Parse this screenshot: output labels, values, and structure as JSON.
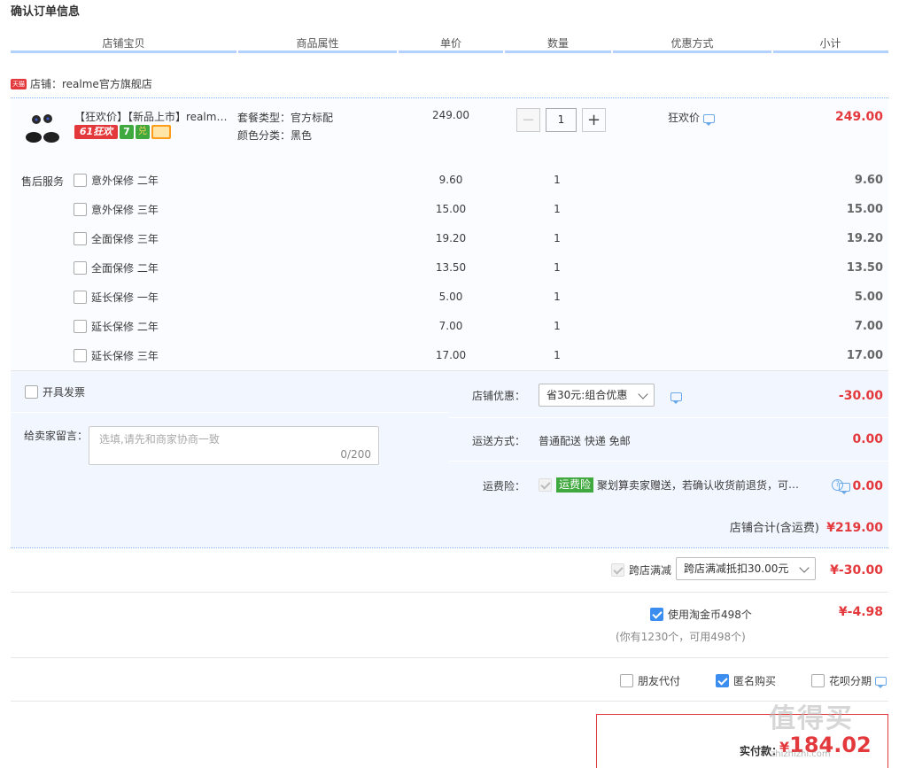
{
  "page_title": "确认订单信息",
  "columns": [
    "店铺宝贝",
    "商品属性",
    "单价",
    "数量",
    "优惠方式",
    "小计"
  ],
  "shop": {
    "badge": "天猫",
    "label": "店铺：realme官方旗舰店"
  },
  "product": {
    "title": "【狂欢价】【新品上市】realme真无线蓝牙耳机",
    "tags": {
      "t61": "61狂欢",
      "t7": "7",
      "tj": "兑"
    },
    "attr_package": "套餐类型：官方标配",
    "attr_color": "颜色分类：黑色",
    "unit_price": "249.00",
    "quantity": "1",
    "minus": "−",
    "plus": "+",
    "promo": "狂欢价",
    "subtotal": "249.00"
  },
  "services_label": "售后服务",
  "services": [
    {
      "name": "意外保修 二年",
      "price": "9.60",
      "qty": "1",
      "subtotal": "9.60"
    },
    {
      "name": "意外保修 三年",
      "price": "15.00",
      "qty": "1",
      "subtotal": "15.00"
    },
    {
      "name": "全面保修 三年",
      "price": "19.20",
      "qty": "1",
      "subtotal": "19.20"
    },
    {
      "name": "全面保修 二年",
      "price": "13.50",
      "qty": "1",
      "subtotal": "13.50"
    },
    {
      "name": "延长保修 一年",
      "price": "5.00",
      "qty": "1",
      "subtotal": "5.00"
    },
    {
      "name": "延长保修 二年",
      "price": "7.00",
      "qty": "1",
      "subtotal": "7.00"
    },
    {
      "name": "延长保修 三年",
      "price": "17.00",
      "qty": "1",
      "subtotal": "17.00"
    }
  ],
  "invoice_label": "开具发票",
  "message": {
    "label": "给卖家留言：",
    "placeholder": "选填,请先和商家协商一致",
    "counter": "0/200"
  },
  "shop_discount": {
    "label": "店铺优惠：",
    "selected": "省30元:组合优惠",
    "amount": "-30.00"
  },
  "shipping": {
    "label": "运送方式：",
    "value": "普通配送 快递 免邮",
    "amount": "0.00"
  },
  "insurance": {
    "label": "运费险：",
    "tag": "运费险",
    "text": "聚划算卖家赠送，若确认收货前退货，可获保险赔付",
    "help": "?",
    "amount": "0.00"
  },
  "shop_total": {
    "label": "店铺合计(含运费)",
    "amount": "¥219.00"
  },
  "cross_store": {
    "label": "跨店满减",
    "selected": "跨店满减抵扣30.00元",
    "amount": "¥-30.00"
  },
  "coins": {
    "label": "使用淘金币498个",
    "hint": "(你有1230个，可用498个)",
    "amount": "¥-4.98"
  },
  "options": {
    "friend_pay": "朋友代付",
    "anonymous": "匿名购买",
    "huabei": "花呗分期"
  },
  "pay": {
    "label": "实付款：",
    "currency": "¥",
    "amount": "184.02"
  },
  "watermark": "值得买",
  "watermark_url": "zhizhizhi.com",
  "colors": {
    "accent_red": "#e4393c",
    "header_bar": "#b2d1ff",
    "panel_bg": "#f2f7ff",
    "check_blue": "#3b8ef0",
    "tag_green": "#3fa83e"
  }
}
